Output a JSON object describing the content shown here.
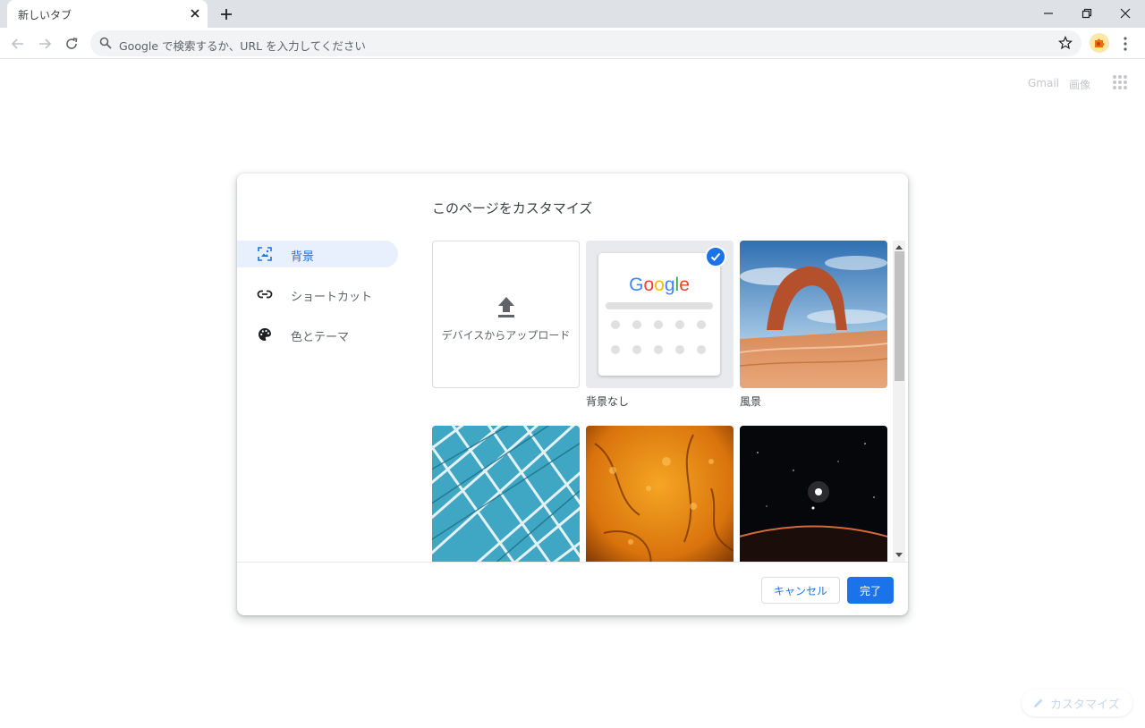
{
  "browser": {
    "tab": {
      "title": "新しいタブ"
    },
    "omnibox": {
      "placeholder": "Google で検索するか、URL を入力してください"
    }
  },
  "ntp": {
    "links": {
      "gmail": "Gmail",
      "images": "画像"
    },
    "customize_button": "カスタマイズ"
  },
  "dialog": {
    "title": "このページをカスタマイズ",
    "sidebar": [
      {
        "label": "背景",
        "icon": "wallpaper-icon",
        "active": true
      },
      {
        "label": "ショートカット",
        "icon": "link-icon",
        "active": false
      },
      {
        "label": "色とテーマ",
        "icon": "palette-icon",
        "active": false
      }
    ],
    "tiles": {
      "upload_label": "デバイスからアップロード",
      "no_background_label": "背景なし",
      "landscape_label": "風景",
      "google_logo": "Google"
    },
    "buttons": {
      "cancel": "キャンセル",
      "done": "完了"
    }
  },
  "colors": {
    "accent": "#1a73e8",
    "active_nav_bg": "#e8f0fe",
    "tab_strip": "#dee1e6"
  }
}
